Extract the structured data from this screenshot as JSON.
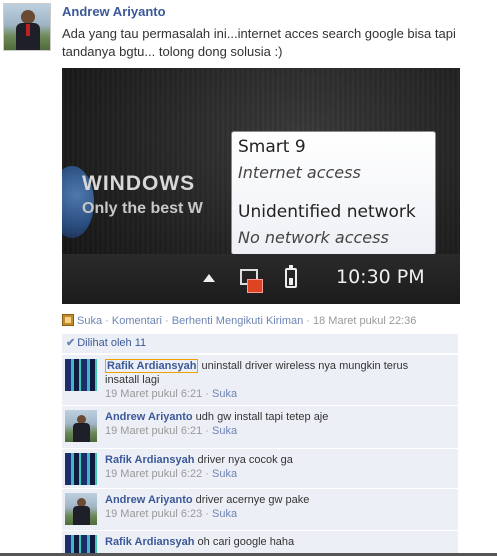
{
  "post": {
    "author": "Andrew Ariyanto",
    "text": "Ada yang tau permasalah ini...internet acces search google bisa tapi tandanya bgtu... tolong dong solusia :)"
  },
  "screenshot": {
    "brand_title": "WINDOWS",
    "brand_subtitle": "Only the best W",
    "tooltip": {
      "network1": "Smart  9",
      "network1_status": "Internet access",
      "network2": "Unidentified network",
      "network2_status": "No network access"
    },
    "clock": "10:30 PM"
  },
  "actions": {
    "like": "Suka",
    "sep1": " · ",
    "comment": "Komentari",
    "sep2": " · ",
    "unfollow": "Berhenti Mengikuti Kiriman",
    "sep3": " · ",
    "timestamp": "18 Maret pukul 22:36"
  },
  "seen": {
    "label": "Dilihat oleh 11"
  },
  "comments": [
    {
      "author": "Rafik Ardiansyah",
      "text": "uninstall driver wireless nya mungkin terus insatall lagi",
      "time": "19 Maret pukul 6:21",
      "like": "Suka",
      "sep": " · "
    },
    {
      "author": "Andrew Ariyanto",
      "text": "udh gw install tapi tetep aje",
      "time": "19 Maret pukul 6:21",
      "like": "Suka",
      "sep": " · "
    },
    {
      "author": "Rafik Ardiansyah",
      "text": "driver nya cocok ga",
      "time": "19 Maret pukul 6:22",
      "like": "Suka",
      "sep": " · "
    },
    {
      "author": "Andrew Ariyanto",
      "text": "driver acernye gw pake",
      "time": "19 Maret pukul 6:23",
      "like": "Suka",
      "sep": " · "
    },
    {
      "author": "Rafik Ardiansyah",
      "text": "oh cari google haha",
      "time": "",
      "like": "",
      "sep": ""
    }
  ],
  "colors": {
    "link": "#3b5998",
    "comment_bg": "#eceff5",
    "muted": "#999999"
  }
}
